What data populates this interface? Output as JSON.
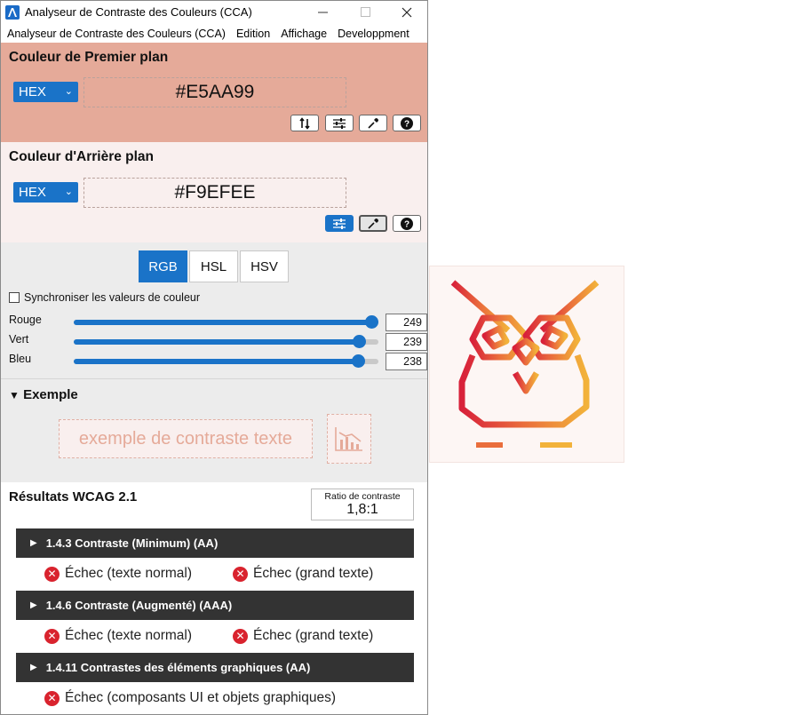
{
  "window": {
    "title": "Analyseur de Contraste des Couleurs (CCA)",
    "minimize_icon": "minimize-icon",
    "maximize_icon": "maximize-icon",
    "close_icon": "close-icon"
  },
  "menu": {
    "items": [
      "Analyseur de Contraste des Couleurs (CCA)",
      "Edition",
      "Affichage",
      "Developpment"
    ]
  },
  "foreground": {
    "title": "Couleur de Premier plan",
    "format": "HEX",
    "value": "#E5AA99",
    "color": "#e5aa99"
  },
  "background": {
    "title": "Couleur d'Arrière plan",
    "format": "HEX",
    "value": "#F9EFEE",
    "color": "#f9efee"
  },
  "mode_tabs": [
    "RGB",
    "HSL",
    "HSV"
  ],
  "sync_label": "Synchroniser les valeurs de couleur",
  "sliders": [
    {
      "label": "Rouge",
      "value": "249",
      "fraction": 0.976
    },
    {
      "label": "Vert",
      "value": "239",
      "fraction": 0.937
    },
    {
      "label": "Bleu",
      "value": "238",
      "fraction": 0.933
    }
  ],
  "example": {
    "title": "Exemple",
    "sample_text": "exemple de contraste texte",
    "chart_icon": "chart-icon"
  },
  "results": {
    "title": "Résultats WCAG 2.1",
    "ratio_label": "Ratio de contraste",
    "ratio_value": "1,8:1",
    "criteria": [
      {
        "label": "1.4.3 Contraste (Minimum) (AA)",
        "fails": [
          "Échec (texte normal)",
          "Échec (grand texte)"
        ]
      },
      {
        "label": "1.4.6 Contraste (Augmenté) (AAA)",
        "fails": [
          "Échec (texte normal)",
          "Échec (grand texte)"
        ]
      },
      {
        "label": "1.4.11 Contrastes des éléments graphiques (AA)",
        "fails": [
          "Échec (composants UI et objets graphiques)"
        ]
      }
    ]
  },
  "colors": {
    "accent": "#1a73c8",
    "fail": "#d9232e",
    "bar": "#333333"
  }
}
